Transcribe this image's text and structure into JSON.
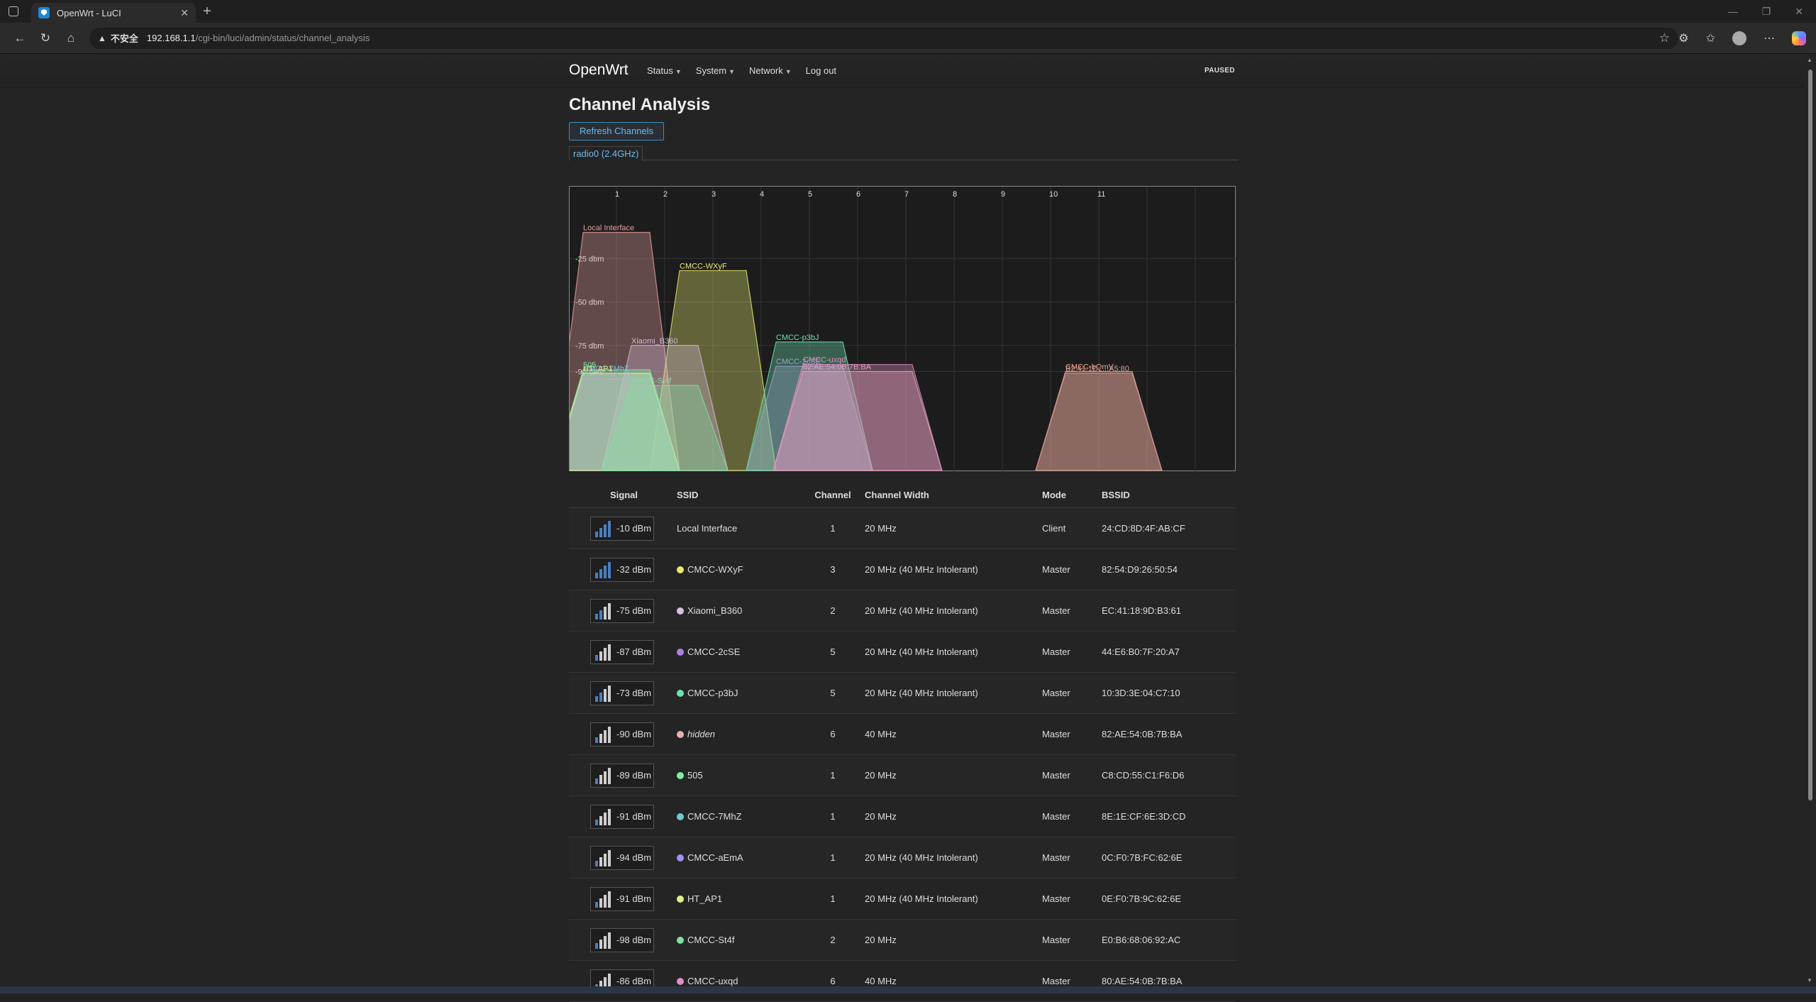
{
  "browser": {
    "tab_title": "OpenWrt - LuCI",
    "url_warning": "不安全",
    "url_host": "192.168.1.1",
    "url_path": "/cgi-bin/luci/admin/status/channel_analysis"
  },
  "header": {
    "brand": "OpenWrt",
    "menu": [
      "Status",
      "System",
      "Network",
      "Log out"
    ],
    "status": "PAUSED"
  },
  "page": {
    "title": "Channel Analysis",
    "refresh_label": "Refresh Channels",
    "radio_tab": "radio0 (2.4GHz)"
  },
  "chart_data": {
    "type": "area",
    "x_channels": [
      "1",
      "2",
      "3",
      "4",
      "5",
      "6",
      "7",
      "8",
      "9",
      "10",
      "11"
    ],
    "y_ticks": [
      "-25 dbm",
      "-50 dbm",
      "-75 dbm",
      "-90 dbm"
    ],
    "ylim": [
      -100,
      0
    ],
    "series": [
      {
        "name": "Local Interface",
        "channel": 1,
        "signal": -10,
        "width": 20,
        "color": "#e8a0a0"
      },
      {
        "name": "CMCC-WXyF",
        "channel": 3,
        "signal": -32,
        "width": 20,
        "color": "#e8e870"
      },
      {
        "name": "Xiaomi_B360",
        "channel": 2,
        "signal": -75,
        "width": 20,
        "color": "#d0b8d8"
      },
      {
        "name": "CMCC-2cSE",
        "channel": 5,
        "signal": -87,
        "width": 20,
        "color": "#b080e0"
      },
      {
        "name": "CMCC-p3bJ",
        "channel": 5,
        "signal": -73,
        "width": 20,
        "color": "#70e0b0"
      },
      {
        "name": "82:AE:54:0B:7B:BA",
        "channel": 6,
        "signal": -90,
        "width": 40,
        "color": "#e8b0b0"
      },
      {
        "name": "505",
        "channel": 1,
        "signal": -89,
        "width": 20,
        "color": "#80f0a0"
      },
      {
        "name": "CMCC-7MhZ",
        "channel": 1,
        "signal": -91,
        "width": 20,
        "color": "#70c8d0"
      },
      {
        "name": "CMCC-aEmA",
        "channel": 1,
        "signal": -94,
        "width": 20,
        "color": "#a090f0"
      },
      {
        "name": "HT_AP1",
        "channel": 1,
        "signal": -91,
        "width": 20,
        "color": "#e0f090"
      },
      {
        "name": "CMCC-St4f",
        "channel": 2,
        "signal": -98,
        "width": 20,
        "color": "#80e0a0"
      },
      {
        "name": "CMCC-uxqd",
        "channel": 6,
        "signal": -86,
        "width": 40,
        "color": "#e090c8"
      },
      {
        "name": "CMCC-bQmV",
        "channel": 11,
        "signal": -90,
        "width": 20,
        "color": "#f0a080"
      },
      {
        "name": "B2:41:1D:...:A5:80",
        "channel": 11,
        "signal": -91,
        "width": 20,
        "color": "#d0a0a0"
      }
    ]
  },
  "table": {
    "headers": [
      "Signal",
      "SSID",
      "Channel",
      "Channel Width",
      "Mode",
      "BSSID"
    ],
    "rows": [
      {
        "signal": "-10 dBm",
        "ssid": "Local Interface",
        "channel": "1",
        "width": "20 MHz",
        "mode": "Client",
        "bssid": "24:CD:8D:4F:AB:CF",
        "color": "",
        "bars": 4
      },
      {
        "signal": "-32 dBm",
        "ssid": "CMCC-WXyF",
        "channel": "3",
        "width": "20 MHz (40 MHz Intolerant)",
        "mode": "Master",
        "bssid": "82:54:D9:26:50:54",
        "color": "#e8e870",
        "bars": 4
      },
      {
        "signal": "-75 dBm",
        "ssid": "Xiaomi_B360",
        "channel": "2",
        "width": "20 MHz (40 MHz Intolerant)",
        "mode": "Master",
        "bssid": "EC:41:18:9D:B3:61",
        "color": "#d8c0e0",
        "bars": 2
      },
      {
        "signal": "-87 dBm",
        "ssid": "CMCC-2cSE",
        "channel": "5",
        "width": "20 MHz (40 MHz Intolerant)",
        "mode": "Master",
        "bssid": "44:E6:B0:7F:20:A7",
        "color": "#b080e0",
        "bars": 1
      },
      {
        "signal": "-73 dBm",
        "ssid": "CMCC-p3bJ",
        "channel": "5",
        "width": "20 MHz (40 MHz Intolerant)",
        "mode": "Master",
        "bssid": "10:3D:3E:04:C7:10",
        "color": "#70e0b0",
        "bars": 2
      },
      {
        "signal": "-90 dBm",
        "ssid": "hidden",
        "channel": "6",
        "width": "40 MHz",
        "mode": "Master",
        "bssid": "82:AE:54:0B:7B:BA",
        "color": "#e8b0b0",
        "bars": 1,
        "italic": true
      },
      {
        "signal": "-89 dBm",
        "ssid": "505",
        "channel": "1",
        "width": "20 MHz",
        "mode": "Master",
        "bssid": "C8:CD:55:C1:F6:D6",
        "color": "#80f0a0",
        "bars": 1
      },
      {
        "signal": "-91 dBm",
        "ssid": "CMCC-7MhZ",
        "channel": "1",
        "width": "20 MHz",
        "mode": "Master",
        "bssid": "8E:1E:CF:6E:3D:CD",
        "color": "#70c8d0",
        "bars": 1
      },
      {
        "signal": "-94 dBm",
        "ssid": "CMCC-aEmA",
        "channel": "1",
        "width": "20 MHz (40 MHz Intolerant)",
        "mode": "Master",
        "bssid": "0C:F0:7B:FC:62:6E",
        "color": "#a090f0",
        "bars": 1
      },
      {
        "signal": "-91 dBm",
        "ssid": "HT_AP1",
        "channel": "1",
        "width": "20 MHz (40 MHz Intolerant)",
        "mode": "Master",
        "bssid": "0E:F0:7B:9C:62:6E",
        "color": "#e0f090",
        "bars": 1
      },
      {
        "signal": "-98 dBm",
        "ssid": "CMCC-St4f",
        "channel": "2",
        "width": "20 MHz",
        "mode": "Master",
        "bssid": "E0:B6:68:06:92:AC",
        "color": "#80e0a0",
        "bars": 1
      },
      {
        "signal": "-86 dBm",
        "ssid": "CMCC-uxqd",
        "channel": "6",
        "width": "40 MHz",
        "mode": "Master",
        "bssid": "80:AE:54:0B:7B:BA",
        "color": "#e090c8",
        "bars": 1
      }
    ]
  }
}
